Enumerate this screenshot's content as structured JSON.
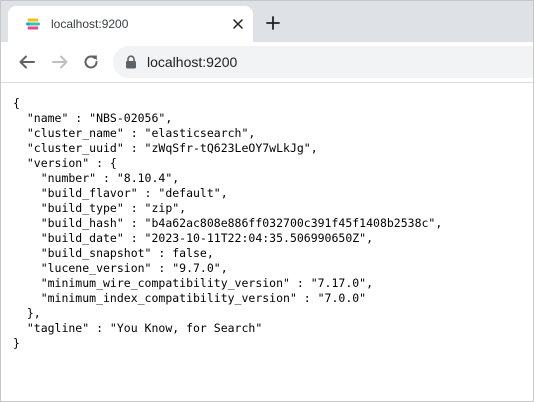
{
  "tab": {
    "title": "localhost:9200"
  },
  "icons": {
    "favicon": "elasticsearch-logo",
    "close": "close-icon",
    "new_tab": "plus-icon",
    "back": "back-arrow-icon",
    "forward": "forward-arrow-icon",
    "reload": "reload-icon",
    "lock": "lock-icon"
  },
  "address_bar": {
    "url": "localhost:9200"
  },
  "colors": {
    "tabstrip": "#dee1e6",
    "omnibox": "#f1f3f4",
    "favicon_yellow": "#f0bf1a",
    "favicon_teal": "#3ebeb0",
    "favicon_pink": "#e9478b",
    "favicon_blue": "#07a5de"
  },
  "page": {
    "lines": [
      "{",
      "  \"name\" : \"NBS-02056\",",
      "  \"cluster_name\" : \"elasticsearch\",",
      "  \"cluster_uuid\" : \"zWqSfr-tQ623LeOY7wLkJg\",",
      "  \"version\" : {",
      "    \"number\" : \"8.10.4\",",
      "    \"build_flavor\" : \"default\",",
      "    \"build_type\" : \"zip\",",
      "    \"build_hash\" : \"b4a62ac808e886ff032700c391f45f1408b2538c\",",
      "    \"build_date\" : \"2023-10-11T22:04:35.506990650Z\",",
      "    \"build_snapshot\" : false,",
      "    \"lucene_version\" : \"9.7.0\",",
      "    \"minimum_wire_compatibility_version\" : \"7.17.0\",",
      "    \"minimum_index_compatibility_version\" : \"7.0.0\"",
      "  },",
      "  \"tagline\" : \"You Know, for Search\"",
      "}"
    ]
  }
}
